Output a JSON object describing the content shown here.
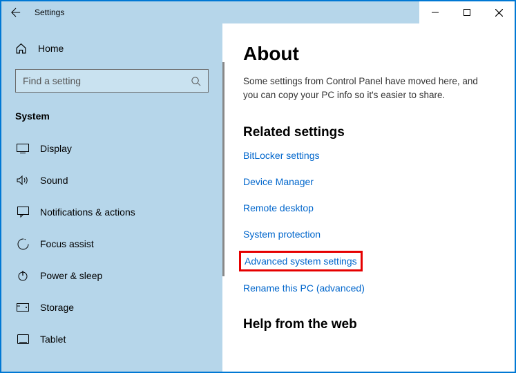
{
  "window": {
    "title": "Settings"
  },
  "sidebar": {
    "home_label": "Home",
    "search_placeholder": "Find a setting",
    "category_label": "System",
    "items": [
      {
        "label": "Display"
      },
      {
        "label": "Sound"
      },
      {
        "label": "Notifications & actions"
      },
      {
        "label": "Focus assist"
      },
      {
        "label": "Power & sleep"
      },
      {
        "label": "Storage"
      },
      {
        "label": "Tablet"
      }
    ]
  },
  "main": {
    "title": "About",
    "description": "Some settings from Control Panel have moved here, and you can copy your PC info so it's easier to share.",
    "related_heading": "Related settings",
    "links": [
      {
        "label": "BitLocker settings"
      },
      {
        "label": "Device Manager"
      },
      {
        "label": "Remote desktop"
      },
      {
        "label": "System protection"
      },
      {
        "label": "Advanced system settings",
        "highlighted": true
      },
      {
        "label": "Rename this PC (advanced)"
      }
    ],
    "help_heading": "Help from the web"
  }
}
